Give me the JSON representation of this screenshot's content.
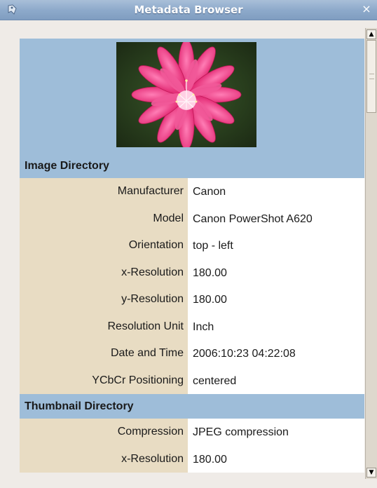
{
  "window": {
    "title": "Metadata Browser",
    "close_glyph": "×",
    "app_icon": "app-icon"
  },
  "sections": [
    {
      "title": "Image Directory",
      "rows": [
        {
          "key": "Manufacturer",
          "value": "Canon"
        },
        {
          "key": "Model",
          "value": "Canon PowerShot A620"
        },
        {
          "key": "Orientation",
          "value": "top - left"
        },
        {
          "key": "x-Resolution",
          "value": "180.00"
        },
        {
          "key": "y-Resolution",
          "value": "180.00"
        },
        {
          "key": "Resolution Unit",
          "value": "Inch"
        },
        {
          "key": "Date and Time",
          "value": "2006:10:23 04:22:08"
        },
        {
          "key": "YCbCr Positioning",
          "value": "centered"
        }
      ]
    },
    {
      "title": "Thumbnail Directory",
      "rows": [
        {
          "key": "Compression",
          "value": "JPEG compression"
        },
        {
          "key": "x-Resolution",
          "value": "180.00"
        }
      ]
    }
  ],
  "scrollbar": {
    "up_glyph": "▲",
    "down_glyph": "▼"
  },
  "colors": {
    "header_bg": "#9ebdd9",
    "key_bg": "#e8dcc3",
    "value_bg": "#ffffff",
    "titlebar": "#8eaacb"
  }
}
